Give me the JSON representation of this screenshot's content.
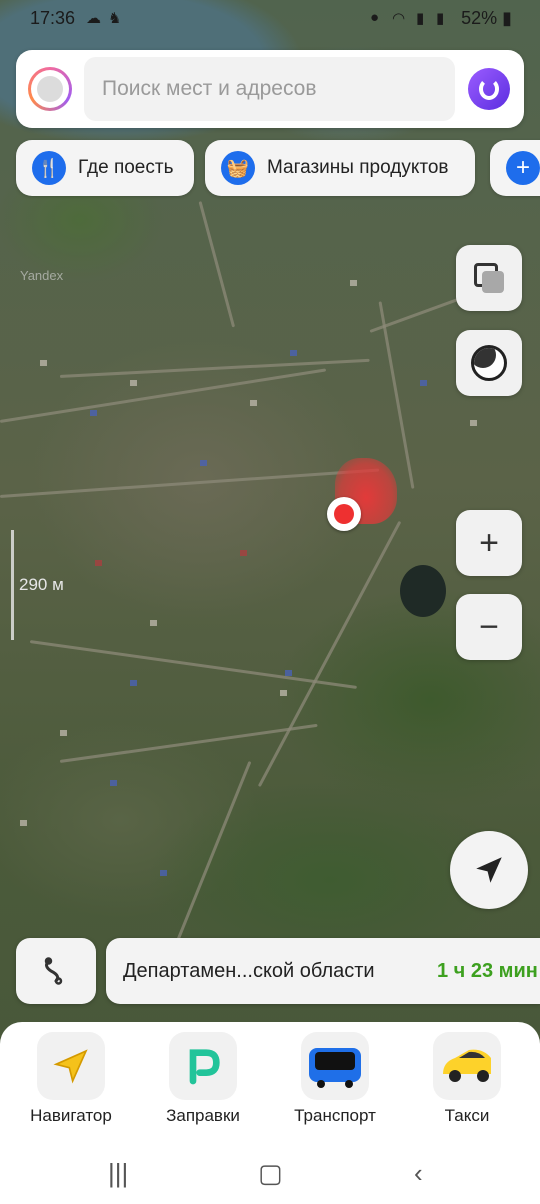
{
  "status": {
    "time": "17:36",
    "battery": "52%"
  },
  "search": {
    "placeholder": "Поиск мест и адресов"
  },
  "chips": [
    {
      "label": "Где поесть",
      "icon": "fork-knife-icon"
    },
    {
      "label": "Магазины продуктов",
      "icon": "basket-icon"
    },
    {
      "label": "",
      "icon": "plus-icon"
    }
  ],
  "map": {
    "scale_label": "290 м",
    "watermark": "Yandex"
  },
  "route": {
    "destination": "Департамен...ской области",
    "duration": "1 ч 23 мин"
  },
  "apps": [
    {
      "label": "Навигатор",
      "icon": "navigator-arrow-icon"
    },
    {
      "label": "Заправки",
      "icon": "fuel-p-icon"
    },
    {
      "label": "Транспорт",
      "icon": "bus-icon"
    },
    {
      "label": "Такси",
      "icon": "taxi-car-icon"
    }
  ],
  "colors": {
    "accent_blue": "#1e6dec",
    "route_time_green": "#3da01f",
    "pin_red": "#ee3030",
    "alice_purple": "#7a3cf0"
  }
}
